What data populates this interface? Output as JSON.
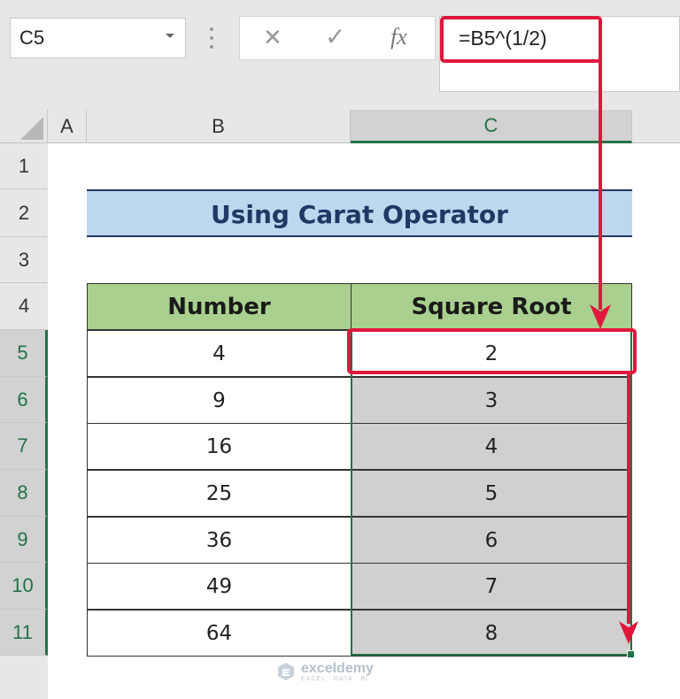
{
  "formula_bar": {
    "name_box": "C5",
    "cancel_symbol": "✕",
    "enter_symbol": "✓",
    "fx_label": "fx",
    "formula": "=B5^(1/2)"
  },
  "columns": [
    "A",
    "B",
    "C"
  ],
  "selected_column": "C",
  "rows": [
    "1",
    "2",
    "3",
    "4",
    "5",
    "6",
    "7",
    "8",
    "9",
    "10",
    "11"
  ],
  "selected_rows": [
    "5",
    "6",
    "7",
    "8",
    "9",
    "10",
    "11"
  ],
  "sheet": {
    "title": "Using Carat Operator",
    "table": {
      "headers": [
        "Number",
        "Square Root"
      ],
      "rows": [
        [
          "4",
          "2"
        ],
        [
          "9",
          "3"
        ],
        [
          "16",
          "4"
        ],
        [
          "25",
          "5"
        ],
        [
          "36",
          "6"
        ],
        [
          "49",
          "7"
        ],
        [
          "64",
          "8"
        ]
      ]
    }
  },
  "watermark": {
    "name": "exceldemy",
    "tagline": "EXCEL · DATA · BI"
  },
  "colors": {
    "accent_green": "#217346",
    "annotation_red": "#e0173d",
    "title_fill": "#bdd7ee",
    "header_fill": "#a9d08e",
    "selection_fill": "#d0d0d0"
  }
}
